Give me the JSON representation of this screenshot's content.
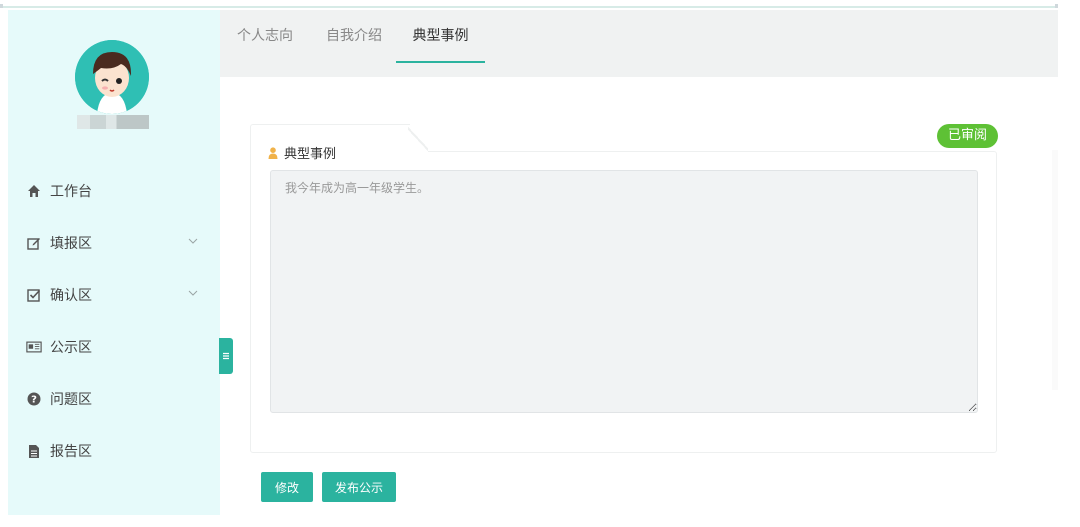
{
  "user": {
    "name": "▇▇▇ ▇▇▇"
  },
  "sidebar": {
    "items": [
      {
        "label": "工作台",
        "icon": "home-icon"
      },
      {
        "label": "填报区",
        "icon": "edit-icon",
        "expandable": true
      },
      {
        "label": "确认区",
        "icon": "checkbox-icon",
        "expandable": true
      },
      {
        "label": "公示区",
        "icon": "newspaper-icon"
      },
      {
        "label": "问题区",
        "icon": "question-icon"
      },
      {
        "label": "报告区",
        "icon": "document-icon"
      }
    ]
  },
  "tabs": [
    {
      "label": "个人志向",
      "active": false
    },
    {
      "label": "自我介绍",
      "active": false
    },
    {
      "label": "典型事例",
      "active": true
    }
  ],
  "card": {
    "title": "典型事例",
    "status": "已审阅",
    "content": "我今年成为高一年级学生。"
  },
  "actions": {
    "edit_label": "修改",
    "publish_label": "发布公示"
  },
  "colors": {
    "accent": "#2bb39f",
    "status": "#5ec135",
    "sidebar_bg": "#e6fafa"
  }
}
